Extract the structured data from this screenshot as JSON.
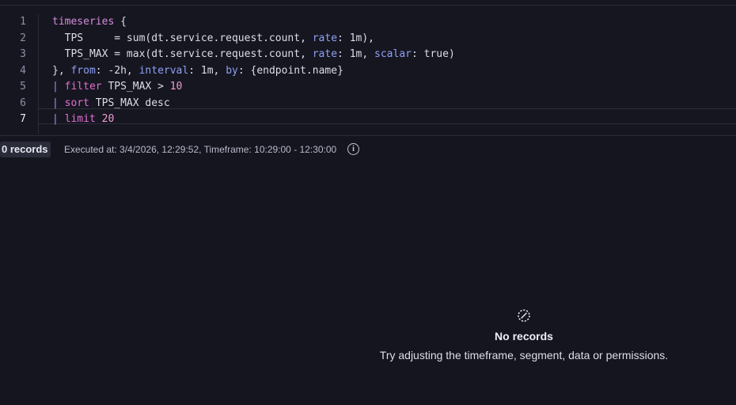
{
  "editor": {
    "line_numbers": [
      "1",
      "2",
      "3",
      "4",
      "5",
      "6",
      "7"
    ],
    "lines": [
      [
        {
          "t": "timeseries",
          "c": "kw"
        },
        {
          "t": " {",
          "c": "plain"
        }
      ],
      [
        {
          "t": "  TPS     = sum(dt.service.request.count, ",
          "c": "plain"
        },
        {
          "t": "rate",
          "c": "param"
        },
        {
          "t": ": 1m),",
          "c": "plain"
        }
      ],
      [
        {
          "t": "  TPS_MAX = max(dt.service.request.count, ",
          "c": "plain"
        },
        {
          "t": "rate",
          "c": "param"
        },
        {
          "t": ": 1m, ",
          "c": "plain"
        },
        {
          "t": "scalar",
          "c": "param"
        },
        {
          "t": ": true)",
          "c": "plain"
        }
      ],
      [
        {
          "t": "}, ",
          "c": "plain"
        },
        {
          "t": "from",
          "c": "param"
        },
        {
          "t": ": -2h, ",
          "c": "plain"
        },
        {
          "t": "interval",
          "c": "param"
        },
        {
          "t": ": 1m, ",
          "c": "plain"
        },
        {
          "t": "by",
          "c": "param"
        },
        {
          "t": ": {endpoint.name}",
          "c": "plain"
        }
      ],
      [
        {
          "t": "| ",
          "c": "pipe"
        },
        {
          "t": "filter",
          "c": "cmd"
        },
        {
          "t": " TPS_MAX > ",
          "c": "plain"
        },
        {
          "t": "10",
          "c": "num"
        }
      ],
      [
        {
          "t": "| ",
          "c": "pipe"
        },
        {
          "t": "sort",
          "c": "cmd"
        },
        {
          "t": " TPS_MAX desc",
          "c": "plain"
        }
      ],
      [
        {
          "t": "| ",
          "c": "pipe"
        },
        {
          "t": "limit",
          "c": "cmd"
        },
        {
          "t": " ",
          "c": "plain"
        },
        {
          "t": "20",
          "c": "num"
        }
      ]
    ],
    "active_line": 7
  },
  "status": {
    "records_badge": "0 records",
    "executed_text": "Executed at: 3/4/2026, 12:29:52, Timeframe: 10:29:00 - 12:30:00",
    "info_icon": "info-icon",
    "info_glyph": "i"
  },
  "empty_state": {
    "icon": "no-records-icon",
    "title": "No records",
    "subtitle": "Try adjusting the timeframe, segment, data or permissions."
  },
  "colors": {
    "background": "#15151f",
    "keyword": "#d48ddc",
    "command": "#e06fd2",
    "parameter": "#8fa0f5",
    "number": "#f29ad7",
    "pipe": "#a98fe6"
  }
}
